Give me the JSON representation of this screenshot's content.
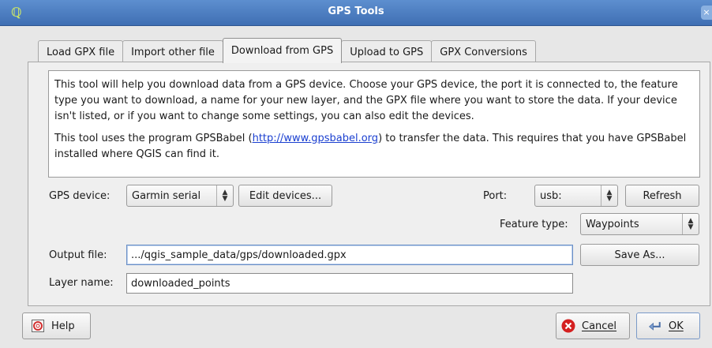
{
  "window": {
    "title": "GPS Tools",
    "close_glyph": "×",
    "app_icon": "qgis-icon"
  },
  "tabs": [
    {
      "label": "Load GPX file",
      "active": false
    },
    {
      "label": "Import other file",
      "active": false
    },
    {
      "label": "Download from GPS",
      "active": true
    },
    {
      "label": "Upload to GPS",
      "active": false
    },
    {
      "label": "GPX Conversions",
      "active": false
    }
  ],
  "info": {
    "paragraph1": "This tool will help you download data from a GPS device. Choose your GPS device, the port it is connected to, the feature type you want to download, a name for your new layer, and the GPX file where you want to store the data. If your device isn't listed, or if you want to change some settings, you can also edit the devices.",
    "paragraph2_before": "This tool uses the program GPSBabel (",
    "paragraph2_link": "http://www.gpsbabel.org",
    "paragraph2_after": ") to transfer the data. This requires that you have GPSBabel installed where QGIS can find it."
  },
  "form": {
    "gps_device_label": "GPS device:",
    "gps_device_value": "Garmin serial",
    "edit_devices_label": "Edit devices...",
    "port_label": "Port:",
    "port_value": "usb:",
    "refresh_label": "Refresh",
    "feature_type_label": "Feature type:",
    "feature_type_value": "Waypoints",
    "output_file_label": "Output file:",
    "output_file_value": ".../qgis_sample_data/gps/downloaded.gpx",
    "save_as_label": "Save As...",
    "layer_name_label": "Layer name:",
    "layer_name_value": "downloaded_points"
  },
  "footer": {
    "help_label": "Help",
    "cancel_label": "Cancel",
    "ok_label": "OK"
  }
}
